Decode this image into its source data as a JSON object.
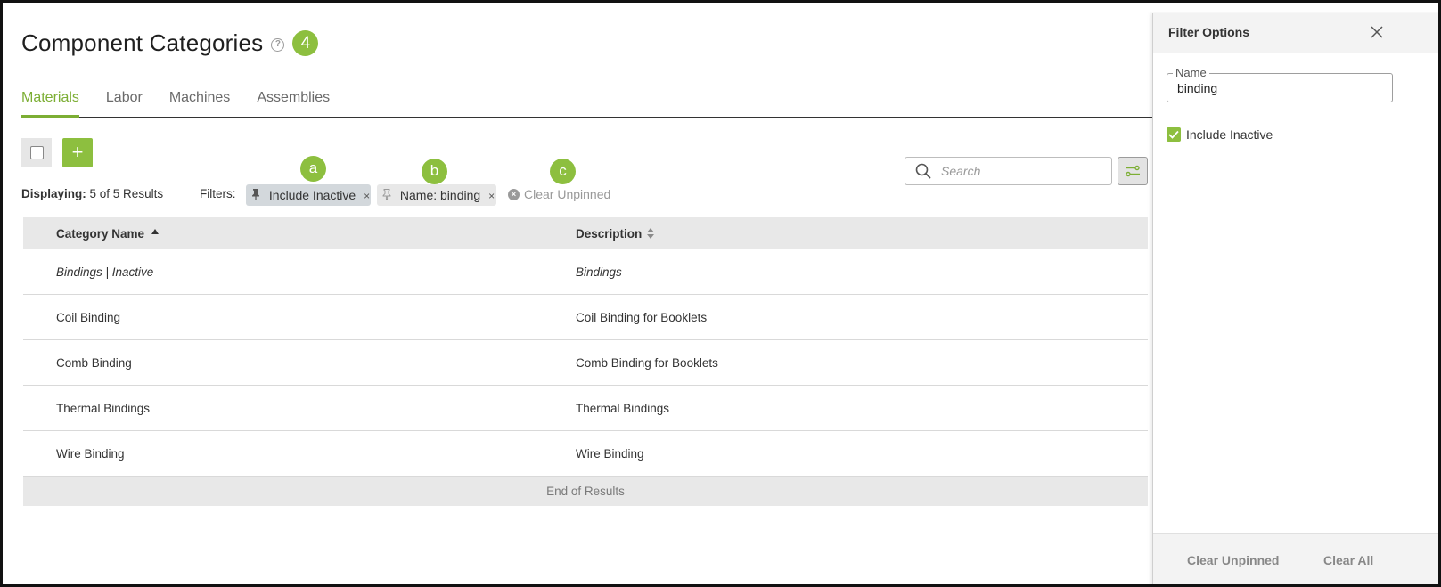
{
  "page": {
    "title": "Component Categories",
    "help_glyph": "?",
    "count_badge": "4"
  },
  "tabs": [
    {
      "label": "Materials",
      "active": true
    },
    {
      "label": "Labor",
      "active": false
    },
    {
      "label": "Machines",
      "active": false
    },
    {
      "label": "Assemblies",
      "active": false
    }
  ],
  "toolbar": {
    "add_glyph": "+",
    "displaying_label": "Displaying:",
    "displaying_value": "5 of 5 Results",
    "filters_label": "Filters:",
    "search_placeholder": "Search"
  },
  "markers": {
    "a": "a",
    "b": "b",
    "c": "c"
  },
  "filter_chips": [
    {
      "label": "Include Inactive",
      "pinned": true,
      "remove": "×"
    },
    {
      "label": "Name: binding",
      "pinned": false,
      "remove": "×"
    }
  ],
  "clear_unpinned_chip": {
    "label": "Clear Unpinned",
    "glyph": "×"
  },
  "table": {
    "headers": {
      "name": "Category Name",
      "description": "Description"
    },
    "rows": [
      {
        "name": "Bindings | Inactive",
        "description": "Bindings",
        "inactive": true
      },
      {
        "name": "Coil Binding",
        "description": "Coil Binding for Booklets",
        "inactive": false
      },
      {
        "name": "Comb Binding",
        "description": "Comb Binding for Booklets",
        "inactive": false
      },
      {
        "name": "Thermal Bindings",
        "description": "Thermal Bindings",
        "inactive": false
      },
      {
        "name": "Wire Binding",
        "description": "Wire Binding",
        "inactive": false
      }
    ],
    "end_text": "End of Results"
  },
  "panel": {
    "title": "Filter Options",
    "name_field": {
      "label": "Name",
      "value": "binding"
    },
    "include_inactive": {
      "label": "Include Inactive",
      "checked": true
    },
    "footer": {
      "clear_unpinned": "Clear Unpinned",
      "clear_all": "Clear All"
    }
  },
  "colors": {
    "accent": "#8dbf3f",
    "active_tab": "#7cae34",
    "pinned_chip": "#d3d8dc",
    "header_bg": "#e8e8e8"
  }
}
